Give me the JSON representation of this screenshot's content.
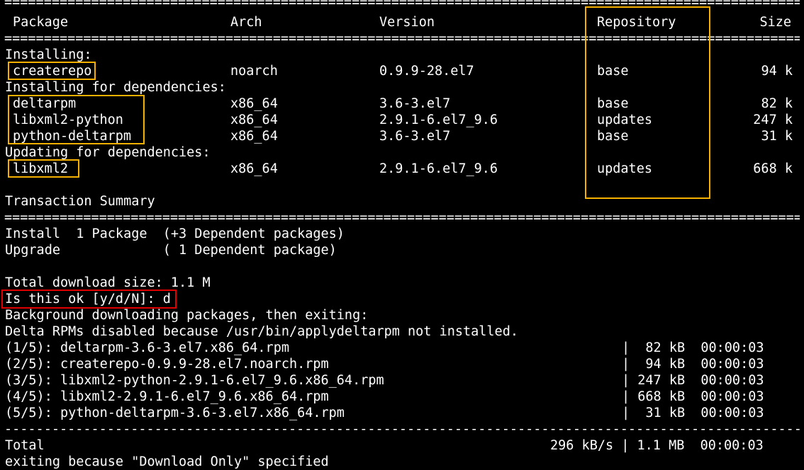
{
  "colors": {
    "background": "#000000",
    "text": "#ffffff",
    "highlight_yellow": "#f5b000",
    "highlight_red": "#e00000"
  },
  "rule_double": "=================================================================================================================",
  "rule_dashed": "-----------------------------------------------------------------------------------------------------------------",
  "header": {
    "package": "Package",
    "arch": "Arch",
    "version": "Version",
    "repository": "Repository",
    "size": "Size"
  },
  "sections": {
    "installing": "Installing:",
    "installing_deps": "Installing for dependencies:",
    "updating_deps": "Updating for dependencies:"
  },
  "packages": [
    {
      "name": "createrepo",
      "arch": "noarch",
      "version": "0.9.9-28.el7",
      "repo": "base",
      "size": "94 k"
    },
    {
      "name": "deltarpm",
      "arch": "x86_64",
      "version": "3.6-3.el7",
      "repo": "base",
      "size": "82 k"
    },
    {
      "name": "libxml2-python",
      "arch": "x86_64",
      "version": "2.9.1-6.el7_9.6",
      "repo": "updates",
      "size": "247 k"
    },
    {
      "name": "python-deltarpm",
      "arch": "x86_64",
      "version": "3.6-3.el7",
      "repo": "base",
      "size": "31 k"
    },
    {
      "name": "libxml2",
      "arch": "x86_64",
      "version": "2.9.1-6.el7_9.6",
      "repo": "updates",
      "size": "668 k"
    }
  ],
  "summary": {
    "title": "Transaction Summary",
    "install": "Install  1 Package  (+3 Dependent packages)",
    "upgrade": "Upgrade             ( 1 Dependent package)"
  },
  "download": {
    "total_size": "Total download size: 1.1 M",
    "prompt": "Is this ok [y/d/N]: d",
    "background": "Background downloading packages, then exiting:",
    "delta_msg": "Delta RPMs disabled because /usr/bin/applydeltarpm not installed."
  },
  "downloads": [
    {
      "file": "(1/5): deltarpm-3.6-3.el7.x86_64.rpm",
      "stats": "|  82 kB  00:00:03"
    },
    {
      "file": "(2/5): createrepo-0.9.9-28.el7.noarch.rpm",
      "stats": "|  94 kB  00:00:03"
    },
    {
      "file": "(3/5): libxml2-python-2.9.1-6.el7_9.6.x86_64.rpm",
      "stats": "| 247 kB  00:00:03"
    },
    {
      "file": "(4/5): libxml2-2.9.1-6.el7_9.6.x86_64.rpm",
      "stats": "| 668 kB  00:00:03"
    },
    {
      "file": "(5/5): python-deltarpm-3.6-3.el7.x86_64.rpm",
      "stats": "|  31 kB  00:00:03"
    }
  ],
  "total": {
    "label": "Total",
    "stats": "296 kB/s | 1.1 MB  00:00:03"
  },
  "exit_msg": "exiting because \"Download Only\" specified"
}
